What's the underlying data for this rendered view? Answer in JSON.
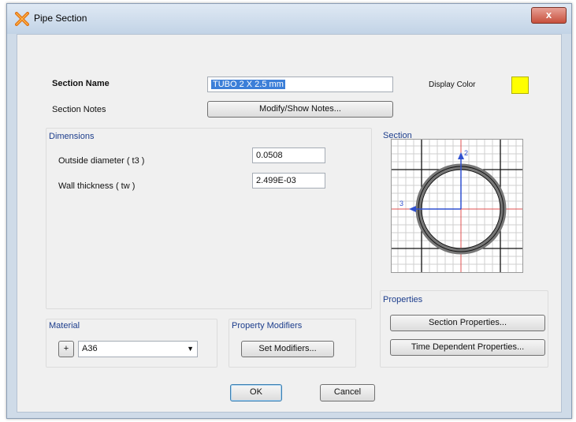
{
  "window": {
    "title": "Pipe Section",
    "close_label": "x"
  },
  "section_name": {
    "label": "Section Name",
    "value": "TUBO 2 X 2.5 mm"
  },
  "section_notes": {
    "label": "Section Notes",
    "button": "Modify/Show Notes..."
  },
  "display_color": {
    "label": "Display Color",
    "color": "#ffff00"
  },
  "dimensions": {
    "title": "Dimensions",
    "outside_diameter": {
      "label": "Outside diameter  ( t3 )",
      "value": "0.0508"
    },
    "wall_thickness": {
      "label": "Wall thickness  ( tw )",
      "value": "2.499E-03"
    }
  },
  "section_preview": {
    "title": "Section",
    "axis_2": "2",
    "axis_3": "3"
  },
  "material": {
    "title": "Material",
    "add_label": "+",
    "value": "A36"
  },
  "property_modifiers": {
    "title": "Property Modifiers",
    "button": "Set Modifiers..."
  },
  "properties": {
    "title": "Properties",
    "section_button": "Section Properties...",
    "time_button": "Time Dependent Properties..."
  },
  "footer": {
    "ok": "OK",
    "cancel": "Cancel"
  }
}
